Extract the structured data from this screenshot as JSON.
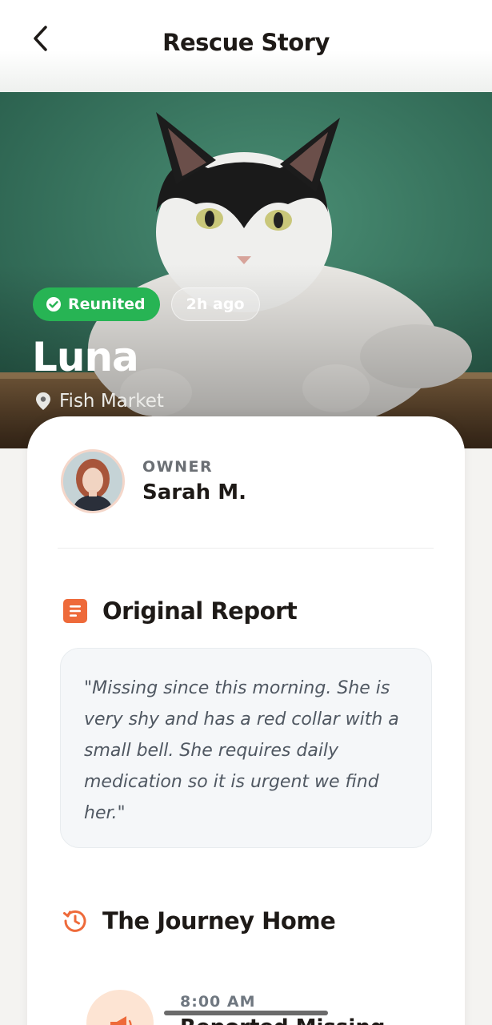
{
  "header": {
    "title": "Rescue Story",
    "back_icon": "chevron-left-icon"
  },
  "hero": {
    "status_badge": "Reunited",
    "time_badge": "2h ago",
    "pet_name": "Luna",
    "location": "Fish Market",
    "status_color": "#27b454"
  },
  "owner": {
    "label": "OWNER",
    "name": "Sarah M."
  },
  "report": {
    "title": "Original Report",
    "text": "\"Missing since this morning. She is very shy and has a red collar with a small bell. She requires daily medication so it is urgent we find her.\""
  },
  "journey": {
    "title": "The Journey Home",
    "events": [
      {
        "time": "8:00 AM",
        "title": "Reported Missing",
        "icon": "megaphone-icon"
      }
    ]
  },
  "colors": {
    "accent": "#ee6a3a",
    "accent_light": "#fde4d3"
  }
}
